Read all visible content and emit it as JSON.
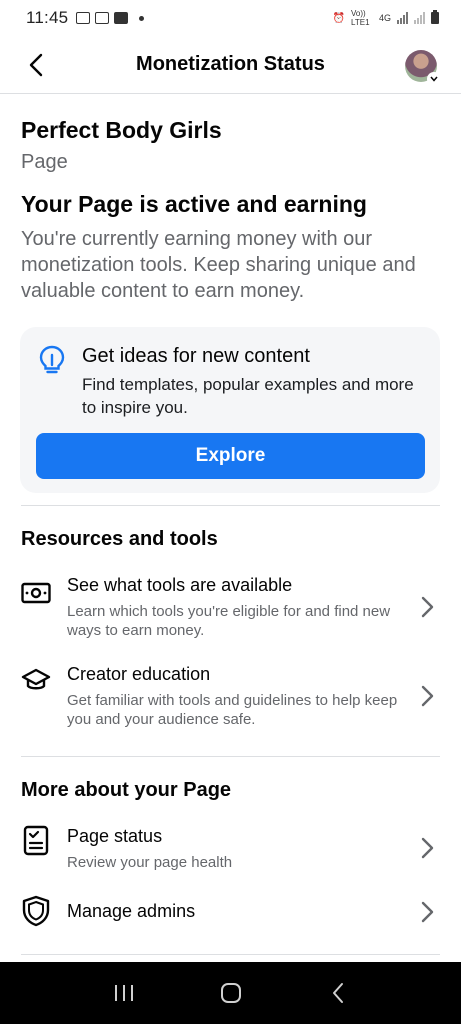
{
  "status_bar": {
    "time": "11:45",
    "network_label": "4G",
    "volte_label": "Vo)) LTE1"
  },
  "header": {
    "title": "Monetization Status",
    "back_icon": "chevron-left-icon",
    "avatar_icon": "profile-avatar"
  },
  "page": {
    "name": "Perfect Body Girls",
    "kind": "Page"
  },
  "status": {
    "title": "Your Page is active and earning",
    "description": "You're currently earning money with our monetization tools. Keep sharing unique and valuable content to earn money."
  },
  "ideas_card": {
    "icon": "lightbulb-icon",
    "title": "Get ideas for new content",
    "description": "Find templates, popular examples and more to inspire you.",
    "button_label": "Explore"
  },
  "resources": {
    "section_title": "Resources and tools",
    "items": [
      {
        "icon": "money-icon",
        "title": "See what tools are available",
        "subtitle": "Learn which tools you're eligible for and find new ways to earn money."
      },
      {
        "icon": "graduation-cap-icon",
        "title": "Creator education",
        "subtitle": "Get familiar with tools and guidelines to help keep you and your audience safe."
      }
    ]
  },
  "more_about": {
    "section_title": "More about your Page",
    "items": [
      {
        "icon": "clipboard-check-icon",
        "title": "Page status",
        "subtitle": "Review your page health"
      },
      {
        "icon": "shield-icon",
        "title": "Manage admins"
      }
    ]
  },
  "colors": {
    "accent": "#1877f2",
    "secondary_text": "#65676b",
    "card_bg": "#f5f6f8"
  }
}
